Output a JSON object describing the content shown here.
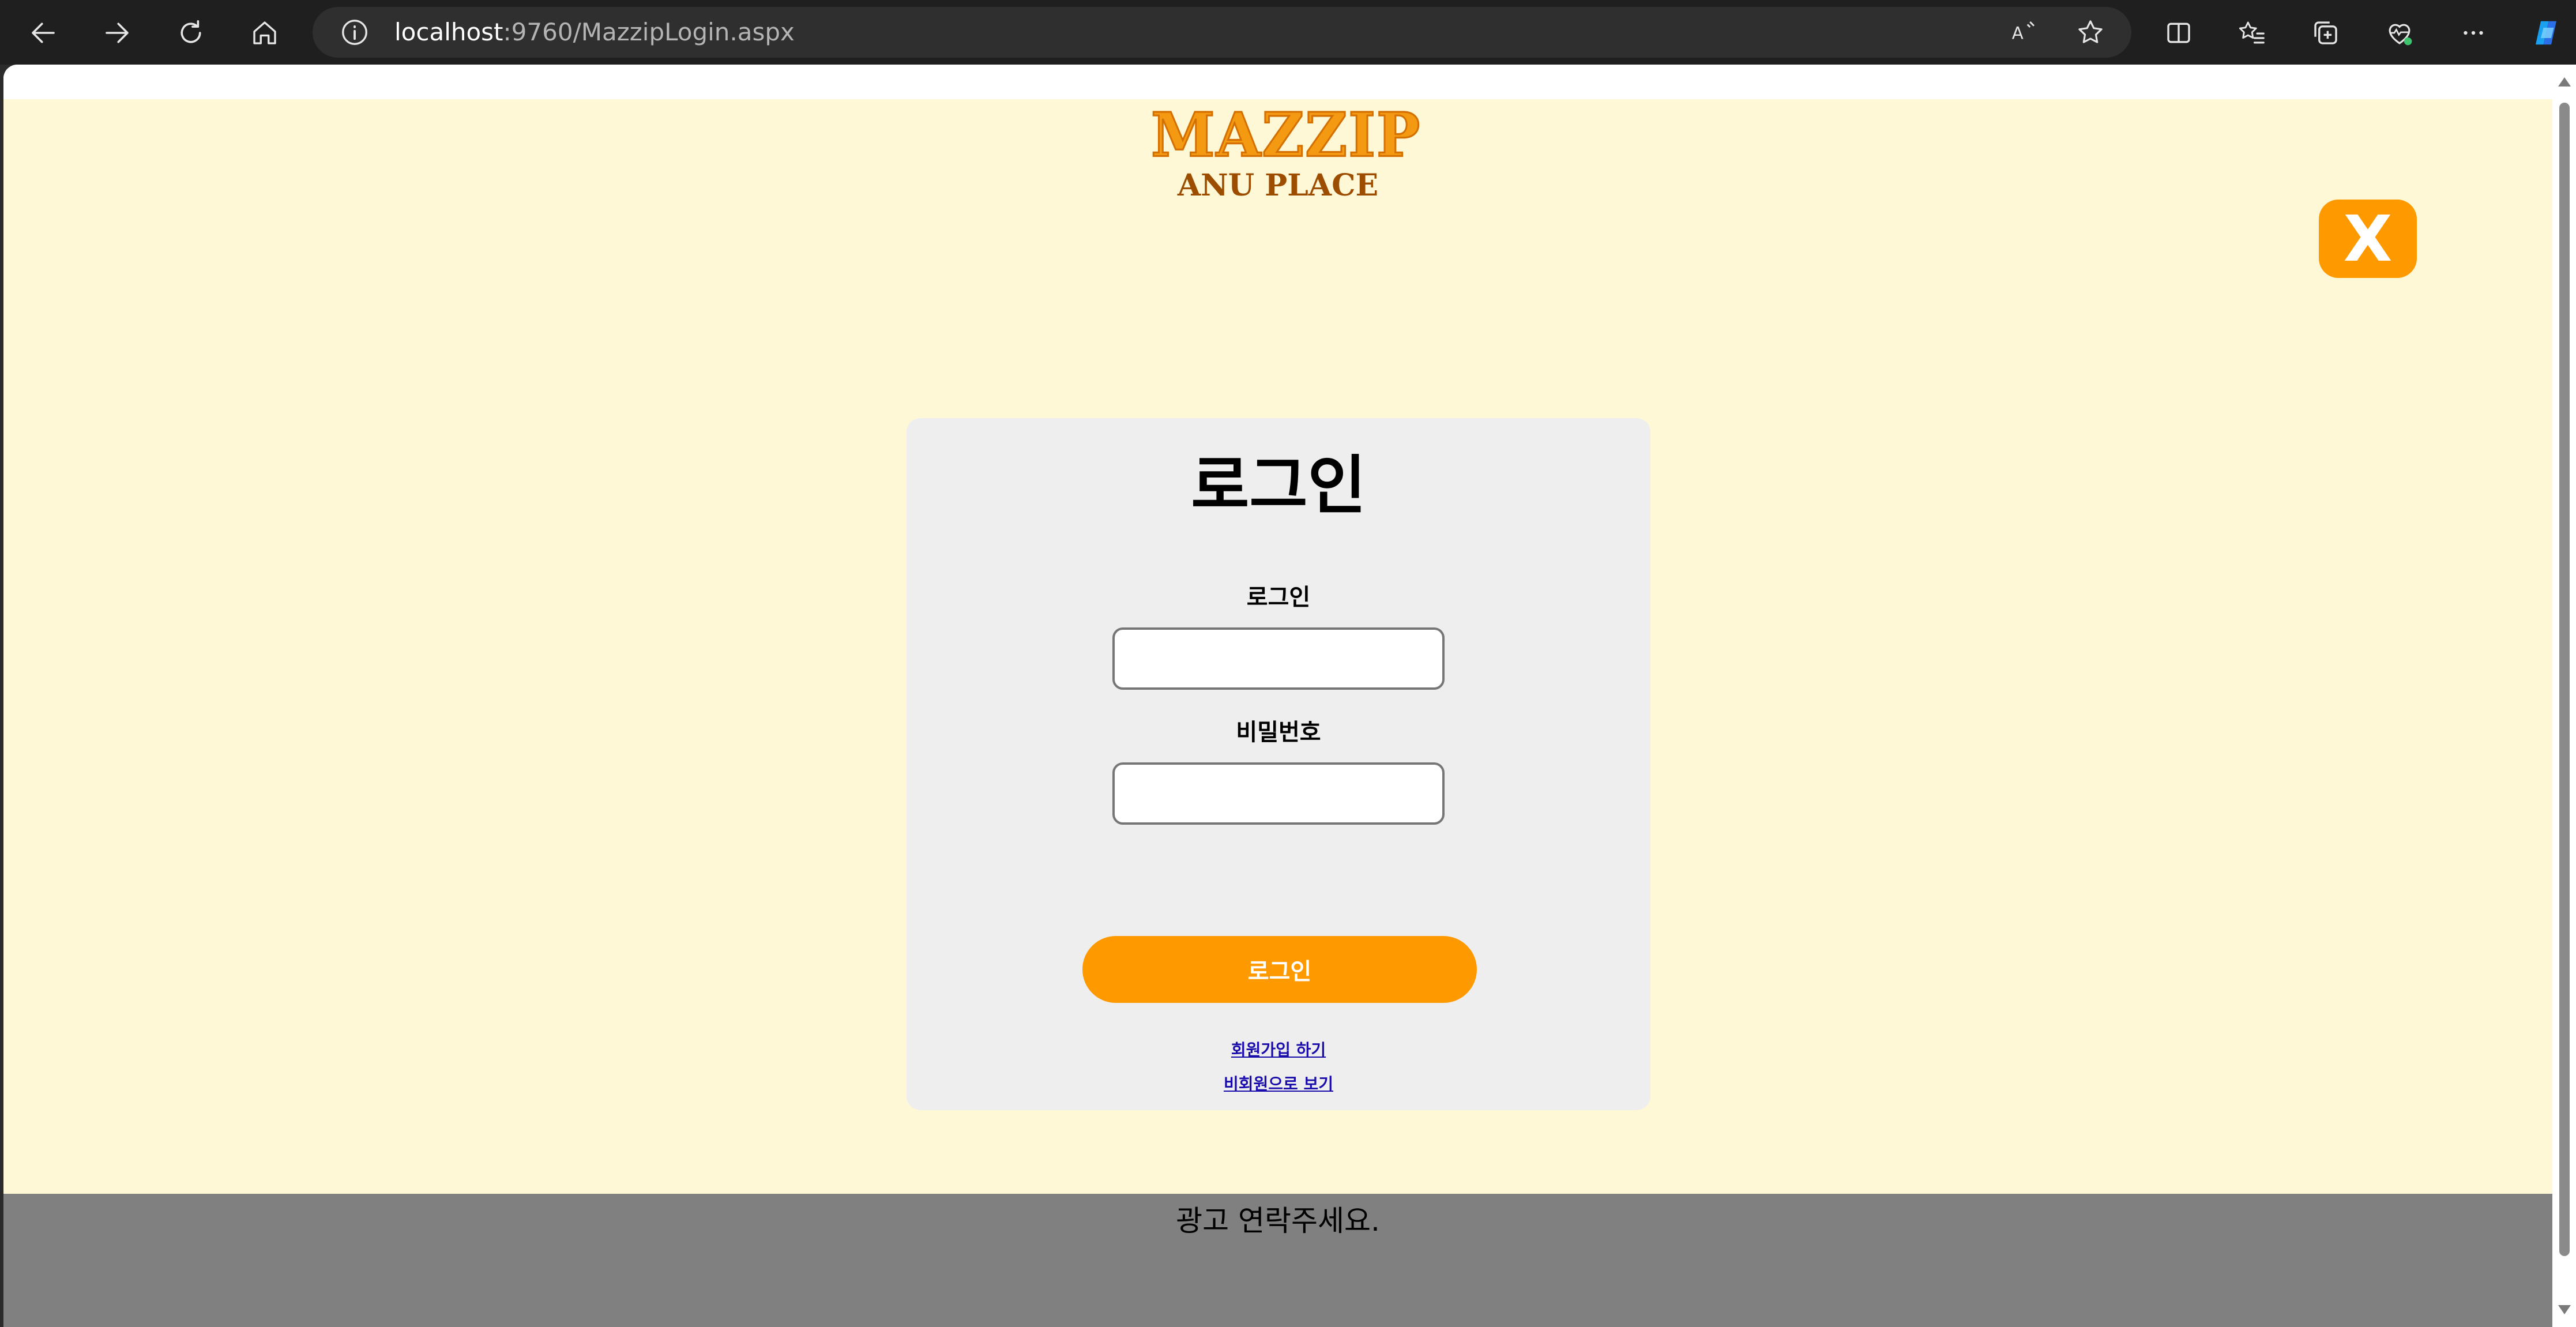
{
  "browser": {
    "url_host": "localhost",
    "url_rest": ":9760/MazzipLogin.aspx"
  },
  "logo": {
    "title": "MAZZIP",
    "subtitle": "ANU PLACE"
  },
  "close_button": {
    "label": "X",
    "color": "#ff9900"
  },
  "login_card": {
    "title": "로그인",
    "id_label": "로그인",
    "id_value": "",
    "password_label": "비밀번호",
    "password_value": "",
    "submit_label": "로그인",
    "signup_link": "회원가입 하기",
    "guest_link": "비회원으로 보기"
  },
  "footer": {
    "text": "광고 연락주세요."
  },
  "colors": {
    "page_background": "#fff8d6",
    "accent": "#ff9900",
    "card_background": "#eeeeee",
    "footer_background": "#808080"
  }
}
